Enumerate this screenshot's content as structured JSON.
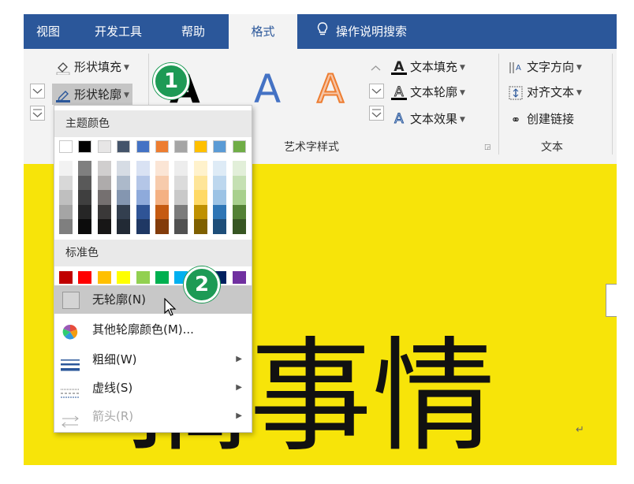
{
  "tabs": [
    {
      "label": "视图"
    },
    {
      "label": "开发工具"
    },
    {
      "label": "帮助"
    },
    {
      "label": "格式"
    },
    {
      "label": "操作说明搜索",
      "icon": "lightbulb-icon"
    }
  ],
  "ribbon": {
    "shape_fill": "形状填充",
    "shape_outline": "形状轮廓",
    "text_fill": "文本填充",
    "text_outline": "文本轮廓",
    "text_effect": "文本效果",
    "text_direction": "文字方向",
    "align_text": "对齐文本",
    "create_link": "创建链接",
    "wordart_group": "艺术字样式",
    "text_group": "文本",
    "wordart_letter": "A"
  },
  "menu": {
    "theme_colors_label": "主题颜色",
    "standard_colors_label": "标准色",
    "theme_top_row": [
      "#ffffff",
      "#000000",
      "#e7e6e6",
      "#44546a",
      "#4472c4",
      "#ed7d31",
      "#a5a5a5",
      "#ffc000",
      "#5b9bd5",
      "#70ad47"
    ],
    "theme_shades": [
      [
        "#f2f2f2",
        "#d8d8d8",
        "#bfbfbf",
        "#a5a5a5",
        "#7f7f7f"
      ],
      [
        "#7f7f7f",
        "#595959",
        "#3f3f3f",
        "#262626",
        "#0c0c0c"
      ],
      [
        "#d0cece",
        "#aeabab",
        "#757070",
        "#3a3838",
        "#171616"
      ],
      [
        "#d6dce4",
        "#acb9ca",
        "#8496b0",
        "#333f4f",
        "#222a35"
      ],
      [
        "#d9e2f3",
        "#b4c6e7",
        "#8eaadb",
        "#2f5496",
        "#1f3864"
      ],
      [
        "#fbe5d5",
        "#f7cbac",
        "#f4b183",
        "#c55a11",
        "#833c0b"
      ],
      [
        "#ededed",
        "#dbdbdb",
        "#c9c9c9",
        "#7b7b7b",
        "#525252"
      ],
      [
        "#fff2cc",
        "#fee599",
        "#ffd965",
        "#bf9000",
        "#7f6000"
      ],
      [
        "#deebf6",
        "#bdd7ee",
        "#9cc3e5",
        "#2e75b5",
        "#1e4e79"
      ],
      [
        "#e2efd9",
        "#c5e0b3",
        "#a8d08d",
        "#538135",
        "#375623"
      ]
    ],
    "standard_colors": [
      "#c00000",
      "#ff0000",
      "#ffc000",
      "#ffff00",
      "#92d050",
      "#00b050",
      "#00b0f0",
      "#0070c0",
      "#002060",
      "#7030a0"
    ],
    "no_outline": "无轮廓(N)",
    "more_colors": "其他轮廓颜色(M)...",
    "weight": "粗细(W)",
    "dashes": "虚线(S)",
    "arrows": "箭头(R)"
  },
  "badges": [
    "1",
    "2"
  ],
  "document": {
    "text": "搞事情",
    "para_mark": "↵"
  }
}
